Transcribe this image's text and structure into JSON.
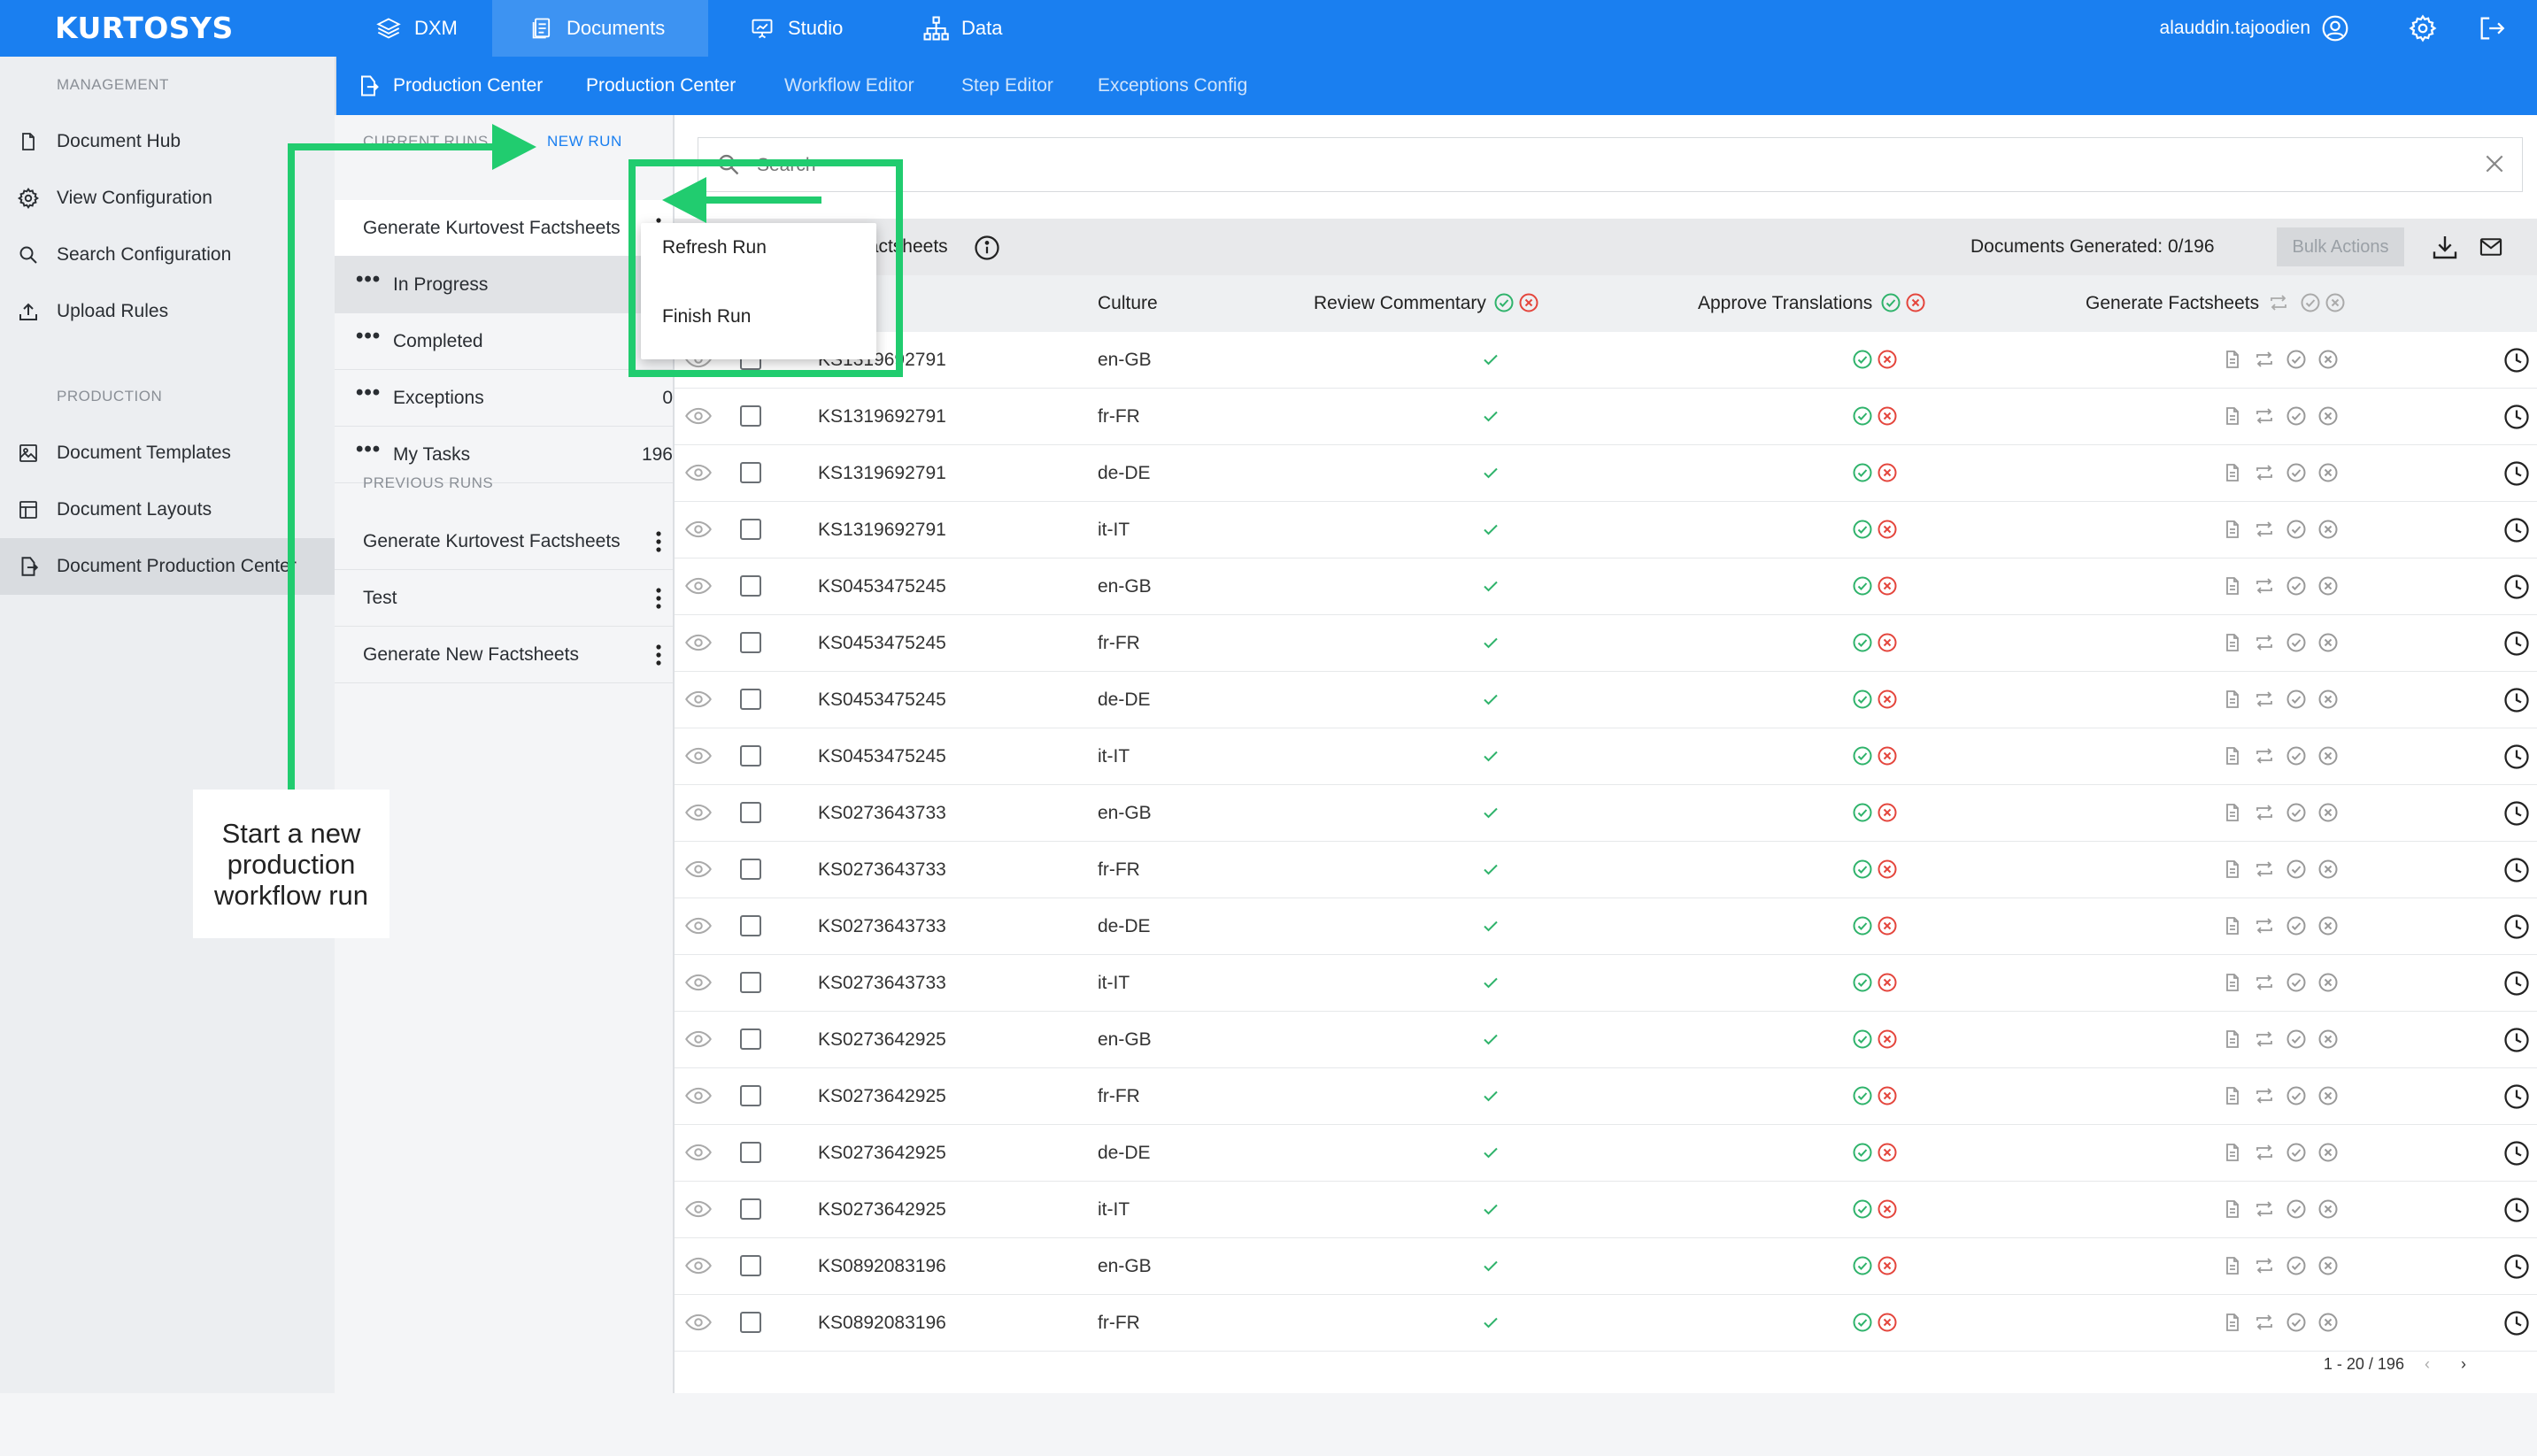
{
  "app": {
    "logo": "KURTOSYS",
    "nav": [
      {
        "label": "DXM",
        "icon": "layers-icon"
      },
      {
        "label": "Documents",
        "icon": "documents-icon",
        "active": true
      },
      {
        "label": "Studio",
        "icon": "presentation-icon"
      },
      {
        "label": "Data",
        "icon": "hierarchy-icon"
      }
    ],
    "user": "alauddin.tajoodien"
  },
  "subnav": {
    "items": [
      "Production Center",
      "Production Center",
      "Workflow Editor",
      "Step Editor",
      "Exceptions Config"
    ]
  },
  "sidebar": {
    "management_head": "MANAGEMENT",
    "management": [
      {
        "label": "Document Hub",
        "icon": "file-icon"
      },
      {
        "label": "View Configuration",
        "icon": "gear-icon"
      },
      {
        "label": "Search Configuration",
        "icon": "search-icon"
      },
      {
        "label": "Upload Rules",
        "icon": "upload-icon"
      }
    ],
    "production_head": "PRODUCTION",
    "production": [
      {
        "label": "Document Templates",
        "icon": "image-icon"
      },
      {
        "label": "Document Layouts",
        "icon": "layout-icon"
      },
      {
        "label": "Document Production Center",
        "icon": "file-export-icon",
        "active": true
      }
    ]
  },
  "runs": {
    "current_head": "CURRENT RUNS",
    "new_run": "NEW RUN",
    "current_run": "Generate Kurtovest Factsheets",
    "statuses": [
      {
        "label": "In Progress",
        "count": ""
      },
      {
        "label": "Completed",
        "count": ""
      },
      {
        "label": "Exceptions",
        "count": "0"
      },
      {
        "label": "My Tasks",
        "count": "196"
      }
    ],
    "previous_head": "PREVIOUS RUNS",
    "previous": [
      "Generate Kurtovest Factsheets",
      "Test",
      "Generate New Factsheets"
    ]
  },
  "menu": {
    "items": [
      "Refresh Run",
      "Finish Run"
    ]
  },
  "main": {
    "search_placeholder": "Search",
    "run_title": "Generate Kurtovest Factsheets",
    "documents_generated": "Documents Generated: 0/196",
    "bulk_actions": "Bulk Actions",
    "columns": {
      "culture": "Culture",
      "review": "Review Commentary",
      "approve": "Approve Translations",
      "generate": "Generate Factsheets"
    },
    "rows": [
      {
        "id": "KS1319692791",
        "culture": "en-GB"
      },
      {
        "id": "KS1319692791",
        "culture": "fr-FR"
      },
      {
        "id": "KS1319692791",
        "culture": "de-DE"
      },
      {
        "id": "KS1319692791",
        "culture": "it-IT"
      },
      {
        "id": "KS0453475245",
        "culture": "en-GB"
      },
      {
        "id": "KS0453475245",
        "culture": "fr-FR"
      },
      {
        "id": "KS0453475245",
        "culture": "de-DE"
      },
      {
        "id": "KS0453475245",
        "culture": "it-IT"
      },
      {
        "id": "KS0273643733",
        "culture": "en-GB"
      },
      {
        "id": "KS0273643733",
        "culture": "fr-FR"
      },
      {
        "id": "KS0273643733",
        "culture": "de-DE"
      },
      {
        "id": "KS0273643733",
        "culture": "it-IT"
      },
      {
        "id": "KS0273642925",
        "culture": "en-GB"
      },
      {
        "id": "KS0273642925",
        "culture": "fr-FR"
      },
      {
        "id": "KS0273642925",
        "culture": "de-DE"
      },
      {
        "id": "KS0273642925",
        "culture": "it-IT"
      },
      {
        "id": "KS0892083196",
        "culture": "en-GB"
      },
      {
        "id": "KS0892083196",
        "culture": "fr-FR"
      }
    ],
    "pager": "1 - 20 / 196"
  },
  "annotation": {
    "callout": "Start a new production workflow run"
  },
  "colors": {
    "brand_blue": "#1a7ff0",
    "highlight_green": "#21cc6f",
    "check_green": "#2fb36b",
    "cancel_red": "#e4453c"
  }
}
